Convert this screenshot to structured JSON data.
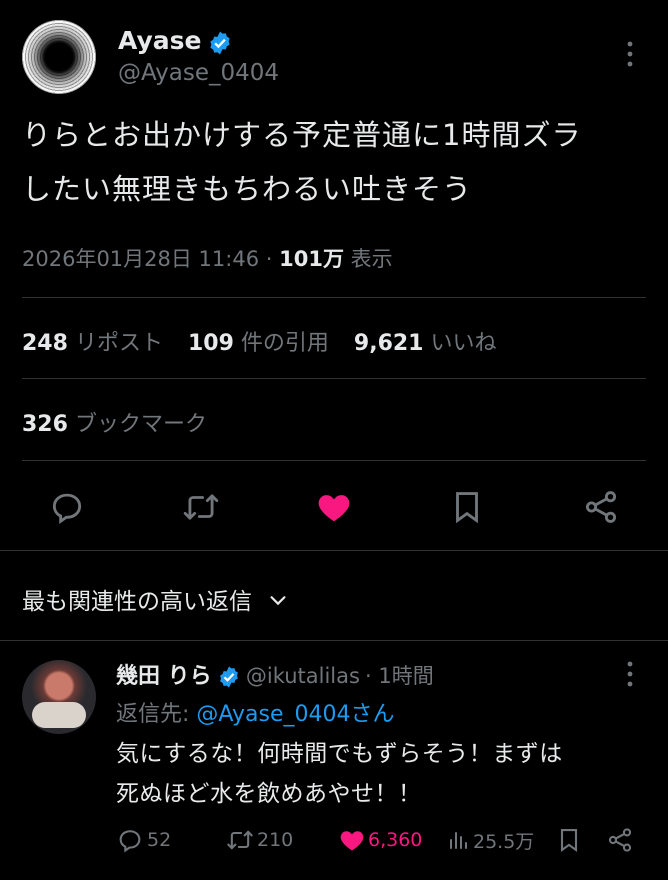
{
  "tweet": {
    "display_name": "Ayase",
    "handle": "@Ayase_0404",
    "text_line1": "りらとお出かけする予定普通に1時間ズラ",
    "text_line2": "したい無理きもちわるい吐きそう",
    "timestamp": "2026年01月28日 11:46 ·",
    "views_count": "101万",
    "views_label": "表示",
    "reposts_count": "248",
    "reposts_label": "リポスト",
    "quotes_count": "109",
    "quotes_label": "件の引用",
    "likes_count": "9,621",
    "likes_label": "いいね",
    "bookmarks_count": "326",
    "bookmarks_label": "ブックマーク",
    "liked": true
  },
  "replies_header": {
    "label": "最も関連性の高い返信"
  },
  "reply": {
    "display_name": "幾田 りら",
    "handle": "@ikutalilas",
    "time": "· 1時間",
    "reply_to_label": "返信先:",
    "reply_to_handle": "@Ayase_0404さん",
    "text_line1": "気にするな！何時間でもずらそう！まずは",
    "text_line2": "死ぬほど水を飲めあやせ！！",
    "replies": "52",
    "reposts": "210",
    "likes": "6,360",
    "views": "25.5万"
  },
  "colors": {
    "background": "#000000",
    "text": "#e7e9ea",
    "muted": "#71767b",
    "accent_blue": "#1d9bf0",
    "like_pink": "#f91880",
    "divider": "#2f3336"
  },
  "icons": [
    "verified-badge-icon",
    "more-icon",
    "reply-icon",
    "repost-icon",
    "like-icon",
    "bookmark-icon",
    "share-icon",
    "chevron-down-icon",
    "views-icon"
  ]
}
